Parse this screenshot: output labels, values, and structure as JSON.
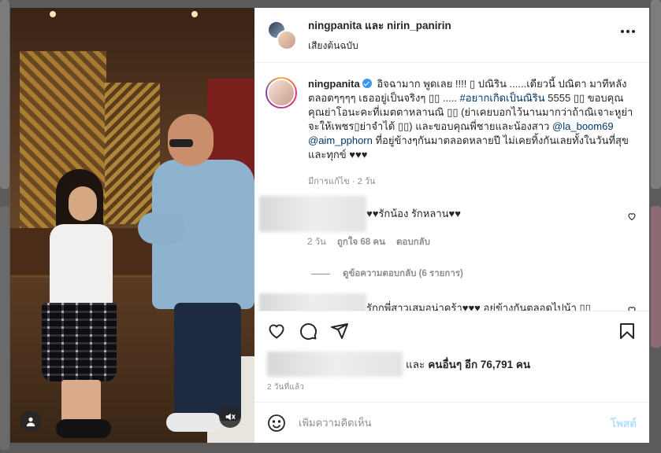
{
  "header": {
    "title_user1": "ningpanita",
    "title_and": "และ",
    "title_user2": "nirin_panirin",
    "subtitle": "เสียงต้นฉบับ"
  },
  "caption": {
    "username": "ningpanita",
    "text_1": "อิจฉามาก พูดเลย !!!! ",
    "text_2": " ปณิริน ......เดียวนี้ ปณิตา มาทีหลังตลอดๆๆๆๆ เธออยู่เป็นจริงๆ ",
    "text_3": " ..... ",
    "hashtag": "#อยากเกิดเป็นณิริน",
    "text_4": " 5555 ",
    "text_5": " ขอบคุณคุณย่าโอนะคะที่เมตตาหลานณิ ",
    "text_6": " (ย่าเคยบอกไว้นานมากว่าถ้าณิเจาะหูย่าจะให้เพชร",
    "text_7": "ย่าจำได้ ",
    "text_8": ") และขอบคุณพี่ชายและน้องสาว ",
    "mention_1": "@la_boom69",
    "mention_2": "@aim_pphorn",
    "text_9": " ที่อยู่ข้างๆกันมาตลอดหลายปี ไม่เคยทิ้งกันเลยทั้งในวันที่สุขและทุกข์ ♥♥♥",
    "glyph": "▯",
    "glyph2": "▯▯",
    "meta": "มีการแก้ไข · 2 วัน"
  },
  "comments": [
    {
      "text": "♥♥รักน้อง รักหลาน♥♥",
      "time": "2 วัน",
      "likes": "ถูกใจ 68 คน",
      "reply": "ตอบกลับ"
    },
    {
      "text": "รักกพี่สาวเสมอน่าคร้า♥♥♥ อยู่ข้างกันตลอดไปน้า ▯▯"
    }
  ],
  "view_replies": "ดูข้อความตอบกลับ (6 รายการ)",
  "likes": {
    "and": "และ",
    "others": "คนอื่นๆ อีก 76,791 คน"
  },
  "posted": "2 วันที่แล้ว",
  "add_comment": {
    "placeholder": "เพิ่มความคิดเห็น",
    "post_label": "โพสต์"
  },
  "colors": {
    "link": "#00376b",
    "verified": "#3897f0",
    "post_button_disabled": "#b2dffc"
  }
}
